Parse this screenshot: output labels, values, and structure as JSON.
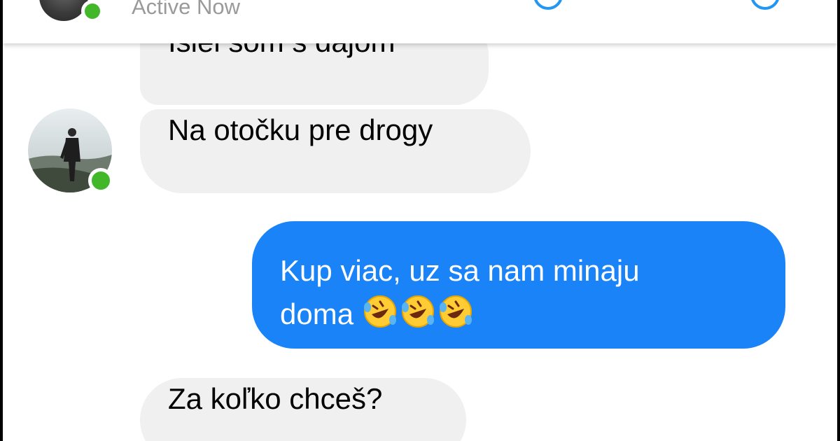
{
  "header": {
    "status": "Active Now",
    "call_icon": "phone-icon",
    "video_icon": "video-camera-icon"
  },
  "messages": [
    {
      "direction": "incoming",
      "text": "Išiel som s dajom"
    },
    {
      "direction": "incoming",
      "text": "Na otočku pre drogy"
    },
    {
      "direction": "outgoing",
      "line1": "Kup viac, uz sa nam minaju",
      "line2": "doma",
      "emoji": "rolling-on-floor-laughing-emoji",
      "emoji_count": 3
    },
    {
      "direction": "incoming",
      "text": "Za koľko chceš?"
    }
  ],
  "colors": {
    "outgoing_bubble": "#1a83f8",
    "incoming_bubble": "#f0f0f0",
    "online": "#42b72a",
    "accent": "#2196f3"
  }
}
